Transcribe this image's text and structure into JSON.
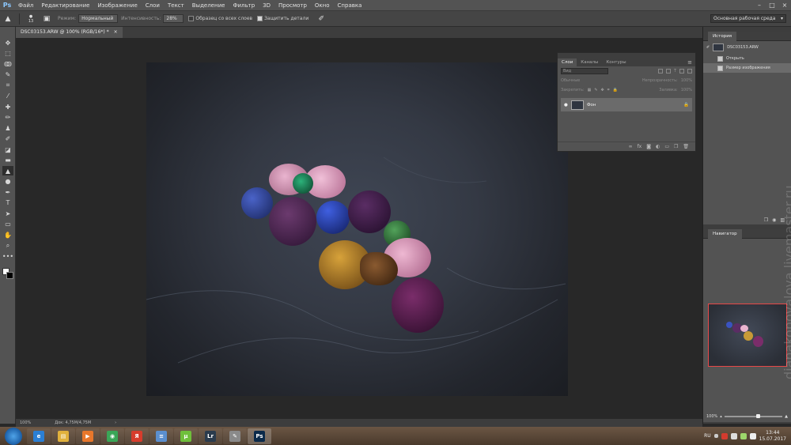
{
  "menubar": {
    "logo": "Ps",
    "items": [
      "Файл",
      "Редактирование",
      "Изображение",
      "Слои",
      "Текст",
      "Выделение",
      "Фильтр",
      "3D",
      "Просмотр",
      "Окно",
      "Справка"
    ],
    "controls": [
      "–",
      "□",
      "×"
    ]
  },
  "options": {
    "mode_label": "Режим:",
    "mode_value": "Нормальный",
    "intensity_label": "Интенсивность:",
    "intensity_value": "28%",
    "sample_all_label": "Образец со всех слоев",
    "protect_label": "Защитить детали",
    "brush_size": "13",
    "workspace": "Основная рабочая среда"
  },
  "document": {
    "tab_title": "DSC03153.ARW @ 100% (RGB/16*) *",
    "tab_close": "×",
    "zoom": "100%",
    "doc_size": "Док: 4,75M/4,75M",
    "status_arrow": "›"
  },
  "toolbar": {
    "tools": [
      {
        "name": "move-tool",
        "glyph": "✥"
      },
      {
        "name": "marquee-tool",
        "glyph": "⬚"
      },
      {
        "name": "lasso-tool",
        "glyph": "ↂ"
      },
      {
        "name": "quick-select-tool",
        "glyph": "✎"
      },
      {
        "name": "crop-tool",
        "glyph": "⌗"
      },
      {
        "name": "eyedropper-tool",
        "glyph": "⁄"
      },
      {
        "name": "healing-tool",
        "glyph": "✚"
      },
      {
        "name": "brush-tool",
        "glyph": "✏"
      },
      {
        "name": "stamp-tool",
        "glyph": "♟"
      },
      {
        "name": "history-brush-tool",
        "glyph": "✐"
      },
      {
        "name": "eraser-tool",
        "glyph": "◪"
      },
      {
        "name": "gradient-tool",
        "glyph": "▬"
      },
      {
        "name": "sharpen-tool",
        "glyph": "▲"
      },
      {
        "name": "dodge-tool",
        "glyph": "●"
      },
      {
        "name": "pen-tool",
        "glyph": "✒"
      },
      {
        "name": "type-tool",
        "glyph": "T"
      },
      {
        "name": "path-select-tool",
        "glyph": "➤"
      },
      {
        "name": "shape-tool",
        "glyph": "▭"
      },
      {
        "name": "hand-tool",
        "glyph": "✋"
      },
      {
        "name": "zoom-tool",
        "glyph": "⌕"
      },
      {
        "name": "more-tools",
        "glyph": "•••"
      }
    ],
    "active_index": 12
  },
  "layers_panel": {
    "tabs": [
      "Слои",
      "Каналы",
      "Контуры"
    ],
    "search_placeholder": "Вид",
    "blend_mode": "Обычные",
    "opacity_label": "Непрозрачность:",
    "opacity_value": "100%",
    "lock_label": "Закрепить:",
    "fill_label": "Заливка:",
    "fill_value": "100%",
    "layer_name": "Фон",
    "footer_icons": [
      "∞",
      "fx",
      "◙",
      "◐",
      "▭",
      "❐",
      "🗑"
    ]
  },
  "history_panel": {
    "title": "История",
    "snapshot": "DSC03153.ARW",
    "items": [
      "Открыть",
      "Размер изображения"
    ],
    "selected_index": 1
  },
  "navigator_panel": {
    "title": "Навигатор",
    "zoom": "100%"
  },
  "watermark": "dianakonovalova.livemaster.ru",
  "taskbar": {
    "apps": [
      {
        "name": "ie",
        "label": "e",
        "color": "#2b7fd4"
      },
      {
        "name": "explorer",
        "label": "▤",
        "color": "#e1b13c"
      },
      {
        "name": "media-player",
        "label": "▶",
        "color": "#e9772b"
      },
      {
        "name": "chrome",
        "label": "◉",
        "color": "#3aa657"
      },
      {
        "name": "yandex",
        "label": "Я",
        "color": "#d73c2c"
      },
      {
        "name": "notes",
        "label": "≡",
        "color": "#5b8fcf"
      },
      {
        "name": "utorrent",
        "label": "µ",
        "color": "#6fbf3b"
      },
      {
        "name": "lightroom",
        "label": "Lr",
        "color": "#2a3b4d"
      },
      {
        "name": "paint",
        "label": "✎",
        "color": "#8a8a8a"
      },
      {
        "name": "photoshop",
        "label": "Ps",
        "color": "#0b2a4a"
      }
    ],
    "active_app": "photoshop",
    "lang": "RU",
    "time": "13:44",
    "date": "15.07.2017"
  }
}
